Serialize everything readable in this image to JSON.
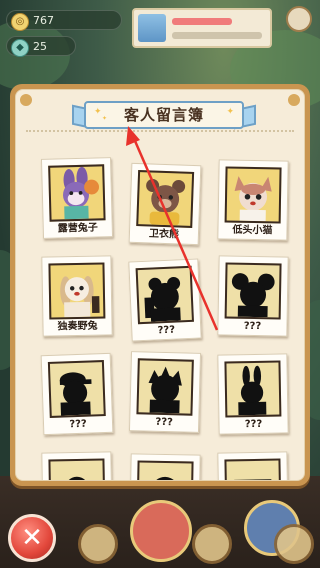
{
  "colors": {
    "panel_frame": "#c99550",
    "panel_paper": "#f6ecd9",
    "ribbon_blue": "#a8d3ef",
    "arrow_red": "#e8322c",
    "photo_yellow": "#f1d67a"
  },
  "top_bar": {
    "coin_value": "767",
    "gem_value": "25"
  },
  "guestbook": {
    "title": "客人留言簿",
    "cards": [
      {
        "name": "露营兔子",
        "known": true,
        "icon": "camping-rabbit-portrait"
      },
      {
        "name": "卫衣熊",
        "known": true,
        "icon": "hoodie-bear-portrait"
      },
      {
        "name": "低头小猫",
        "known": true,
        "icon": "shy-cat-portrait"
      },
      {
        "name": "独奏野兔",
        "known": true,
        "icon": "solo-hare-portrait"
      },
      {
        "name": "???",
        "known": false,
        "icon": "bear-silhouette"
      },
      {
        "name": "???",
        "known": false,
        "icon": "mouse-silhouette"
      },
      {
        "name": "???",
        "known": false,
        "icon": "hat-silhouette"
      },
      {
        "name": "???",
        "known": false,
        "icon": "spiky-silhouette"
      },
      {
        "name": "???",
        "known": false,
        "icon": "rabbit-silhouette"
      }
    ]
  },
  "close_button": {
    "icon": "close-x-icon",
    "glyph": "✕"
  }
}
